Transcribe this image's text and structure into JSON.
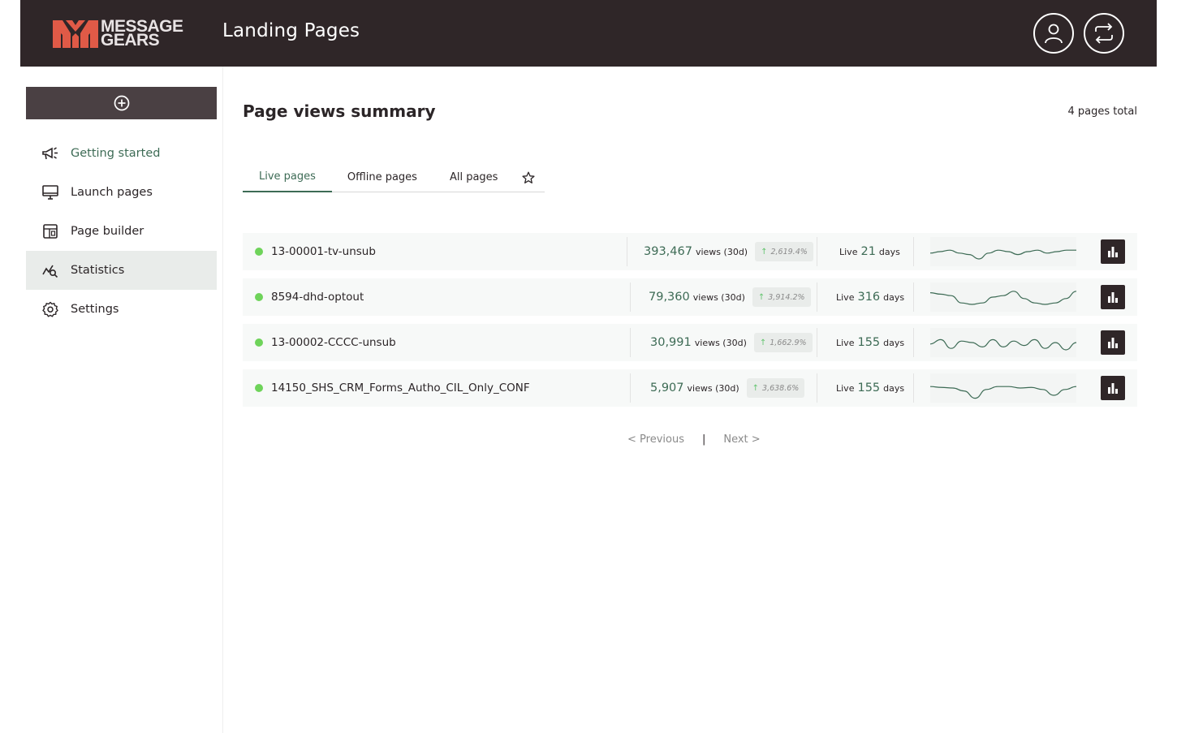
{
  "brand": {
    "logo_text_line1": "MESSAGE",
    "logo_text_line2": "GEARS",
    "logo_color": "#e05a47"
  },
  "header": {
    "title": "Landing Pages",
    "user_icon": "user-icon",
    "switch_icon": "swap-icon"
  },
  "sidebar": {
    "create_icon": "plus-circle-icon",
    "items": [
      {
        "label": "Getting started",
        "icon": "megaphone-icon"
      },
      {
        "label": "Launch pages",
        "icon": "monitor-icon"
      },
      {
        "label": "Page builder",
        "icon": "layout-icon"
      },
      {
        "label": "Statistics",
        "icon": "chart-search-icon"
      },
      {
        "label": "Settings",
        "icon": "gear-icon"
      }
    ]
  },
  "main": {
    "heading": "Page views summary",
    "total": "4 pages total",
    "tabs": [
      {
        "label": "Live pages"
      },
      {
        "label": "Offline pages"
      },
      {
        "label": "All pages"
      }
    ],
    "favorites_icon": "star-icon",
    "rows": [
      {
        "name": "13-00001-tv-unsub",
        "views": "393,467",
        "views_label": "views (30d)",
        "change": "2,619.4%",
        "live_prefix": "Live",
        "live_days": "21",
        "live_suffix": "days",
        "spark": [
          0.55,
          0.5,
          0.45,
          0.55,
          0.6,
          0.75,
          0.55,
          0.45,
          0.5,
          0.6,
          0.5,
          0.45,
          0.55,
          0.5,
          0.45,
          0.45
        ]
      },
      {
        "name": "8594-dhd-optout",
        "views": "79,360",
        "views_label": "views (30d)",
        "change": "3,914.2%",
        "live_prefix": "Live",
        "live_days": "316",
        "live_suffix": "days",
        "spark": [
          0.35,
          0.4,
          0.45,
          0.7,
          0.75,
          0.7,
          0.5,
          0.45,
          0.3,
          0.55,
          0.7,
          0.75,
          0.7,
          0.55,
          0.3
        ]
      },
      {
        "name": "13-00002-CCCC-unsub",
        "views": "30,991",
        "views_label": "views (30d)",
        "change": "1,662.9%",
        "live_prefix": "Live",
        "live_days": "155",
        "live_suffix": "days",
        "spark": [
          0.55,
          0.4,
          0.7,
          0.45,
          0.5,
          0.65,
          0.4,
          0.65,
          0.45,
          0.6,
          0.4,
          0.7,
          0.5,
          0.75,
          0.5
        ]
      },
      {
        "name": "14150_SHS_CRM_Forms_Autho_CIL_Only_CONF",
        "views": "5,907",
        "views_label": "views (30d)",
        "change": "3,638.6%",
        "live_prefix": "Live",
        "live_days": "155",
        "live_suffix": "days",
        "spark": [
          0.45,
          0.48,
          0.5,
          0.6,
          0.85,
          0.55,
          0.45,
          0.45,
          0.5,
          0.48,
          0.55,
          0.75,
          0.55,
          0.45
        ]
      }
    ],
    "pager": {
      "previous": "< Previous",
      "separator": "|",
      "next": "Next >"
    }
  }
}
